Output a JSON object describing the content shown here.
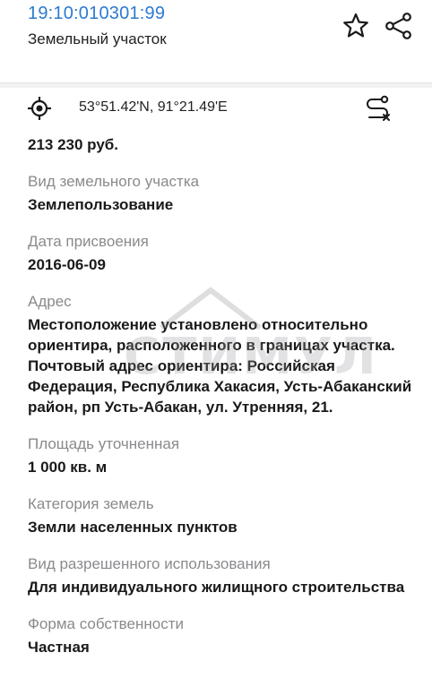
{
  "header": {
    "cadastral_number": "19:10:010301:99",
    "subtitle": "Земельный участок",
    "star_icon": "star-outline-icon",
    "share_icon": "share-icon"
  },
  "location": {
    "coordinates": "53°51.42'N, 91°21.49'E",
    "target_icon": "crosshair-icon",
    "route_icon": "route-cancel-icon"
  },
  "details": {
    "price_value": "213 230 руб.",
    "land_type_label": "Вид земельного участка",
    "land_type_value": "Землепользование",
    "date_label": "Дата присвоения",
    "date_value": "2016-06-09",
    "address_label": "Адрес",
    "address_value": "Местоположение установлено относительно ориентира, расположенного в границах участка. Почтовый адрес ориентира: Российская Федерация, Республика Хакасия, Усть-Абаканский район, рп Усть-Абакан, ул. Утренняя, 21.",
    "area_label": "Площадь уточненная",
    "area_value": "1 000 кв. м",
    "category_label": "Категория земель",
    "category_value": "Земли населенных пунктов",
    "permitted_use_label": "Вид разрешенного использования",
    "permitted_use_value": "Для индивидуального жилищного строительства",
    "ownership_label": "Форма собственности",
    "ownership_value": "Частная"
  },
  "watermark": {
    "text": "СТИМУЛ"
  },
  "colors": {
    "accent": "#2b7bd0",
    "label": "#8a8a8e",
    "text": "#1a1a1a",
    "divider": "#f1f1f3"
  }
}
